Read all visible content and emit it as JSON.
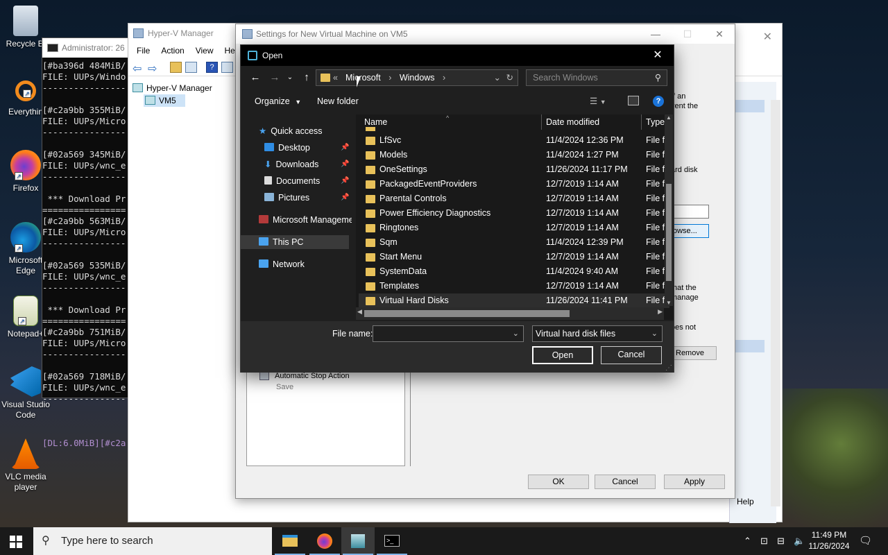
{
  "desktop": {
    "icons": [
      {
        "label": "Recycle Bi",
        "icon": "recycle-bin-icon"
      },
      {
        "label": "Everythin",
        "icon": "everything-search-icon"
      },
      {
        "label": "Firefox",
        "icon": "firefox-icon"
      },
      {
        "label": "Microsoft Edge",
        "icon": "edge-icon"
      },
      {
        "label": "Notepad+",
        "icon": "notepad-plus-plus-icon"
      },
      {
        "label": "Visual Studio Code",
        "icon": "vscode-icon"
      },
      {
        "label": "VLC media player",
        "icon": "vlc-icon"
      }
    ]
  },
  "terminal": {
    "title": "Administrator: 26",
    "lines": [
      "[#ba396d 484MiB/",
      "FILE: UUPs/Windo",
      "----------------",
      "",
      "[#c2a9bb 355MiB/",
      "FILE: UUPs/Micro",
      "----------------",
      "",
      "[#02a569 345MiB/",
      "FILE: UUPs/wnc_e",
      "----------------",
      "",
      " *** Download Pr",
      "================",
      "[#c2a9bb 563MiB/",
      "FILE: UUPs/Micro",
      "----------------",
      "",
      "[#02a569 535MiB/",
      "FILE: UUPs/wnc_e",
      "----------------",
      "",
      " *** Download Pr",
      "================",
      "[#c2a9bb 751MiB/",
      "FILE: UUPs/Micro",
      "----------------",
      "",
      "[#02a569 718MiB/",
      "FILE: UUPs/wnc_e",
      "----------------",
      "",
      "",
      "",
      "[DL:6.0MiB][#c2a"
    ]
  },
  "hyperv": {
    "title": "Hyper-V Manager",
    "menu": [
      "File",
      "Action",
      "View",
      "Help"
    ],
    "tree": [
      "Hyper-V Manager",
      "VM5"
    ],
    "right_help": "Help"
  },
  "settings": {
    "title": "Settings for New Virtual Machine on VM5",
    "left_item": "Automatic Stop Action",
    "left_sub": "Save",
    "right_fragments": [
      "If an",
      "vent the",
      "ard disk",
      "owse...",
      "that the",
      "manage",
      "oes not",
      "Remove"
    ],
    "buttons": {
      "ok": "OK",
      "cancel": "Cancel",
      "apply": "Apply"
    }
  },
  "dialog": {
    "title": "Open",
    "breadcrumb": [
      "Microsoft",
      "Windows"
    ],
    "search_placeholder": "Search Windows",
    "organize": "Organize",
    "new_folder": "New folder",
    "nav": [
      {
        "label": "Quick access",
        "icon": "star-icon"
      },
      {
        "label": "Desktop",
        "icon": "desktop-icon",
        "pinned": true
      },
      {
        "label": "Downloads",
        "icon": "download-icon",
        "pinned": true
      },
      {
        "label": "Documents",
        "icon": "documents-icon",
        "pinned": true
      },
      {
        "label": "Pictures",
        "icon": "pictures-icon",
        "pinned": true
      },
      {
        "label": "Microsoft Management Console",
        "icon": "mmc-icon"
      },
      {
        "label": "This PC",
        "icon": "computer-icon"
      },
      {
        "label": "Network",
        "icon": "network-icon"
      }
    ],
    "columns": {
      "name": "Name",
      "date": "Date modified",
      "type": "Type"
    },
    "files": [
      {
        "name": "LfSvc",
        "date": "11/4/2024 12:36 PM",
        "type": "File f"
      },
      {
        "name": "Models",
        "date": "11/4/2024 1:27 PM",
        "type": "File f"
      },
      {
        "name": "OneSettings",
        "date": "11/26/2024 11:17 PM",
        "type": "File f"
      },
      {
        "name": "PackagedEventProviders",
        "date": "12/7/2019 1:14 AM",
        "type": "File f"
      },
      {
        "name": "Parental Controls",
        "date": "12/7/2019 1:14 AM",
        "type": "File f"
      },
      {
        "name": "Power Efficiency Diagnostics",
        "date": "12/7/2019 1:14 AM",
        "type": "File f"
      },
      {
        "name": "Ringtones",
        "date": "12/7/2019 1:14 AM",
        "type": "File f"
      },
      {
        "name": "Sqm",
        "date": "11/4/2024 12:39 PM",
        "type": "File f"
      },
      {
        "name": "Start Menu",
        "date": "12/7/2019 1:14 AM",
        "type": "File f"
      },
      {
        "name": "SystemData",
        "date": "11/4/2024 9:40 AM",
        "type": "File f"
      },
      {
        "name": "Templates",
        "date": "12/7/2019 1:14 AM",
        "type": "File f"
      },
      {
        "name": "Virtual Hard Disks",
        "date": "11/26/2024 11:41 PM",
        "type": "File f"
      }
    ],
    "filename_label": "File name:",
    "filename_value": "",
    "filter": "Virtual hard disk files",
    "open": "Open",
    "cancel": "Cancel"
  },
  "taskbar": {
    "search_placeholder": "Type here to search",
    "time": "11:49 PM",
    "date": "11/26/2024"
  },
  "colors": {
    "dialog_bg": "#1f1f1f",
    "accent": "#0078d7",
    "folder": "#e8c15a"
  }
}
